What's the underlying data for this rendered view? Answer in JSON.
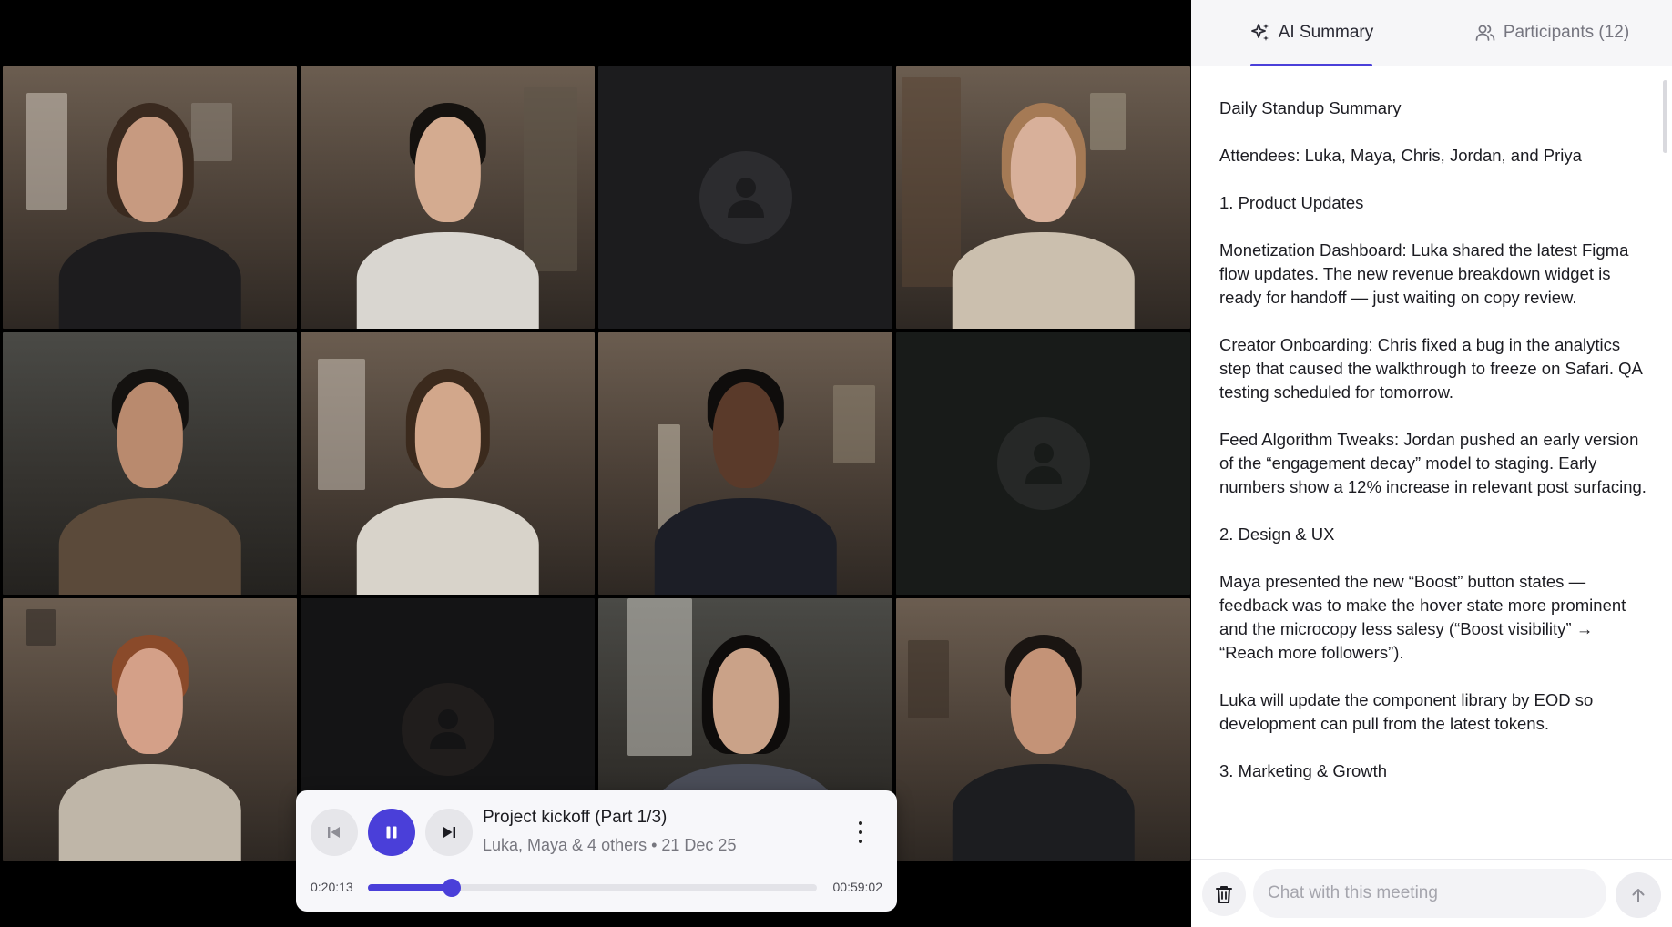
{
  "tabs": [
    {
      "label": "AI Summary",
      "icon": "sparkles-icon",
      "active": true
    },
    {
      "label": "Participants (12)",
      "icon": "users-icon",
      "active": false
    }
  ],
  "summary": {
    "title": "Daily Standup Summary",
    "attendees_label": "Attendees:",
    "attendees": "Luka, Maya, Chris, Jordan, and Priya",
    "section1": "1. Product Updates",
    "para1": "Monetization Dashboard: Luka shared the latest Figma flow updates. The new revenue breakdown widget is ready for handoff — just waiting on copy review.",
    "para2": "Creator Onboarding: Chris fixed a bug in the analytics step that caused the walkthrough to freeze on Safari. QA testing scheduled for tomorrow.",
    "para3": "Feed Algorithm Tweaks: Jordan pushed an early version of the “engagement decay” model to staging. Early numbers show a 12% increase in relevant post surfacing.",
    "section2": "2. Design & UX",
    "para4": "Maya presented the new “Boost” button states — feedback was to make the hover state more prominent and the microcopy less salesy (“Boost visibility” → “Reach more followers”).",
    "para5": "Luka will update the component library by EOD so development can pull from the latest tokens.",
    "section3": "3. Marketing & Growth"
  },
  "chat": {
    "placeholder": "Chat with this meeting",
    "delete_icon": "trash-icon",
    "send_icon": "arrow-up-icon"
  },
  "player": {
    "title": "Project kickoff (Part 1/3)",
    "subtitle": "Luka, Maya & 4 others • 21 Dec 25",
    "current_time": "0:20:13",
    "total_time": "00:59:02",
    "progress": 0.1862,
    "state": "playing",
    "accent": "#4a3fd9"
  },
  "participants_grid": [
    {
      "kind": "camera"
    },
    {
      "kind": "camera"
    },
    {
      "kind": "avatar"
    },
    {
      "kind": "camera"
    },
    {
      "kind": "camera"
    },
    {
      "kind": "camera"
    },
    {
      "kind": "camera"
    },
    {
      "kind": "avatar"
    },
    {
      "kind": "camera"
    },
    {
      "kind": "avatar"
    },
    {
      "kind": "camera"
    },
    {
      "kind": "camera"
    }
  ]
}
